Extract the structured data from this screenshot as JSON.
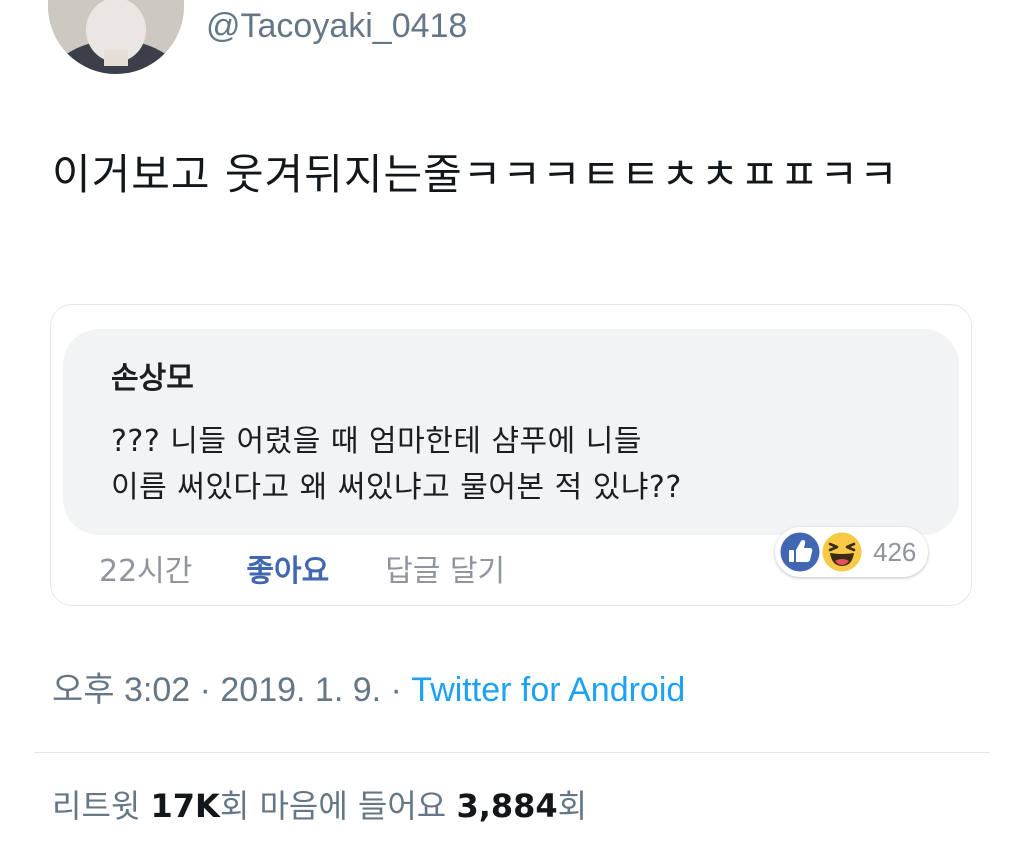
{
  "tweet": {
    "handle": "@Tacoyaki_0418",
    "text": "이거보고 웃겨뒤지는줄ㅋㅋㅋㅌㅌㅊㅊㅍㅍㅋㅋ",
    "timestamp": "오후 3:02 · 2019. 1. 9. · ",
    "source": "Twitter for Android",
    "avatar_icon": "profile-photo"
  },
  "embedded_comment": {
    "author": "손상모",
    "body_line1": "??? 니들 어렸을 때 엄마한테 샴푸에 니들",
    "body_line2": "이름 써있다고 왜 써있냐고 물어본 적 있냐??",
    "time": "22시간",
    "like_label": "좋아요",
    "reply_label": "답글 달기",
    "reactions": {
      "icons": [
        "thumbs-up-icon",
        "laughing-face-icon"
      ],
      "count": "426"
    }
  },
  "stats": {
    "retweet_label": "리트윗 ",
    "retweet_count": "17K",
    "retweet_suffix": "회  마음에 들어요 ",
    "likes_count": "3,884",
    "likes_suffix": "회"
  },
  "colors": {
    "link": "#1da1f2",
    "muted": "#657786",
    "fb_blue": "#4267b2",
    "haha_yellow": "#f7c945"
  }
}
